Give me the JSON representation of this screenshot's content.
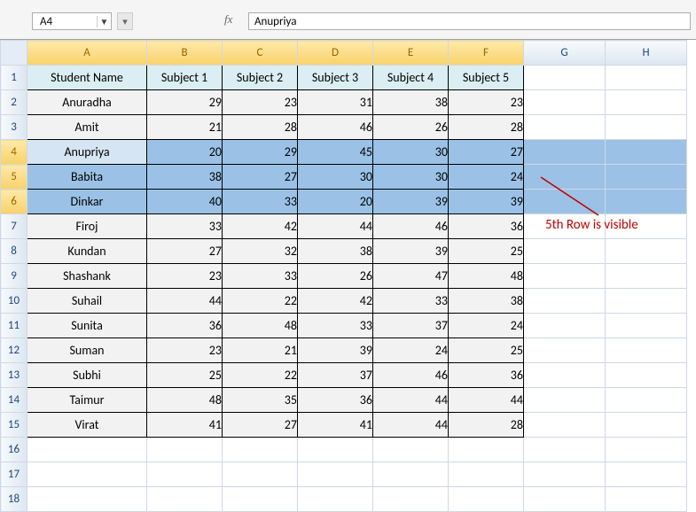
{
  "name_box": {
    "value": "A4"
  },
  "formula_bar": {
    "value": "Anupriya"
  },
  "fx_label": "fx",
  "columns": [
    "A",
    "B",
    "C",
    "D",
    "E",
    "F",
    "G",
    "H"
  ],
  "active_cols": [
    "A",
    "B",
    "C",
    "D",
    "E",
    "F",
    "G",
    "H"
  ],
  "sel_rows": [
    4,
    5,
    6
  ],
  "headers": [
    "Student Name",
    "Subject 1",
    "Subject 2",
    "Subject 3",
    "Subject 4",
    "Subject 5"
  ],
  "rows": [
    {
      "r": 2,
      "name": "Anuradha",
      "v": [
        29,
        23,
        31,
        38,
        23
      ]
    },
    {
      "r": 3,
      "name": "Amit",
      "v": [
        21,
        28,
        46,
        26,
        28
      ]
    },
    {
      "r": 4,
      "name": "Anupriya",
      "v": [
        20,
        29,
        45,
        30,
        27
      ]
    },
    {
      "r": 5,
      "name": "Babita",
      "v": [
        38,
        27,
        30,
        30,
        24
      ]
    },
    {
      "r": 6,
      "name": "Dinkar",
      "v": [
        40,
        33,
        20,
        39,
        39
      ]
    },
    {
      "r": 7,
      "name": "Firoj",
      "v": [
        33,
        42,
        44,
        46,
        36
      ]
    },
    {
      "r": 8,
      "name": "Kundan",
      "v": [
        27,
        32,
        38,
        39,
        25
      ]
    },
    {
      "r": 9,
      "name": "Shashank",
      "v": [
        23,
        33,
        26,
        47,
        48
      ]
    },
    {
      "r": 10,
      "name": "Suhail",
      "v": [
        44,
        22,
        42,
        33,
        38
      ]
    },
    {
      "r": 11,
      "name": "Sunita",
      "v": [
        36,
        48,
        33,
        37,
        24
      ]
    },
    {
      "r": 12,
      "name": "Suman",
      "v": [
        23,
        21,
        39,
        24,
        25
      ]
    },
    {
      "r": 13,
      "name": "Subhi",
      "v": [
        25,
        22,
        37,
        46,
        36
      ]
    },
    {
      "r": 14,
      "name": "Taimur",
      "v": [
        48,
        35,
        36,
        44,
        44
      ]
    },
    {
      "r": 15,
      "name": "Virat",
      "v": [
        41,
        27,
        41,
        44,
        28
      ]
    }
  ],
  "empty_rows": [
    16,
    17,
    18
  ],
  "annotation": {
    "text": "5th Row is visible"
  }
}
